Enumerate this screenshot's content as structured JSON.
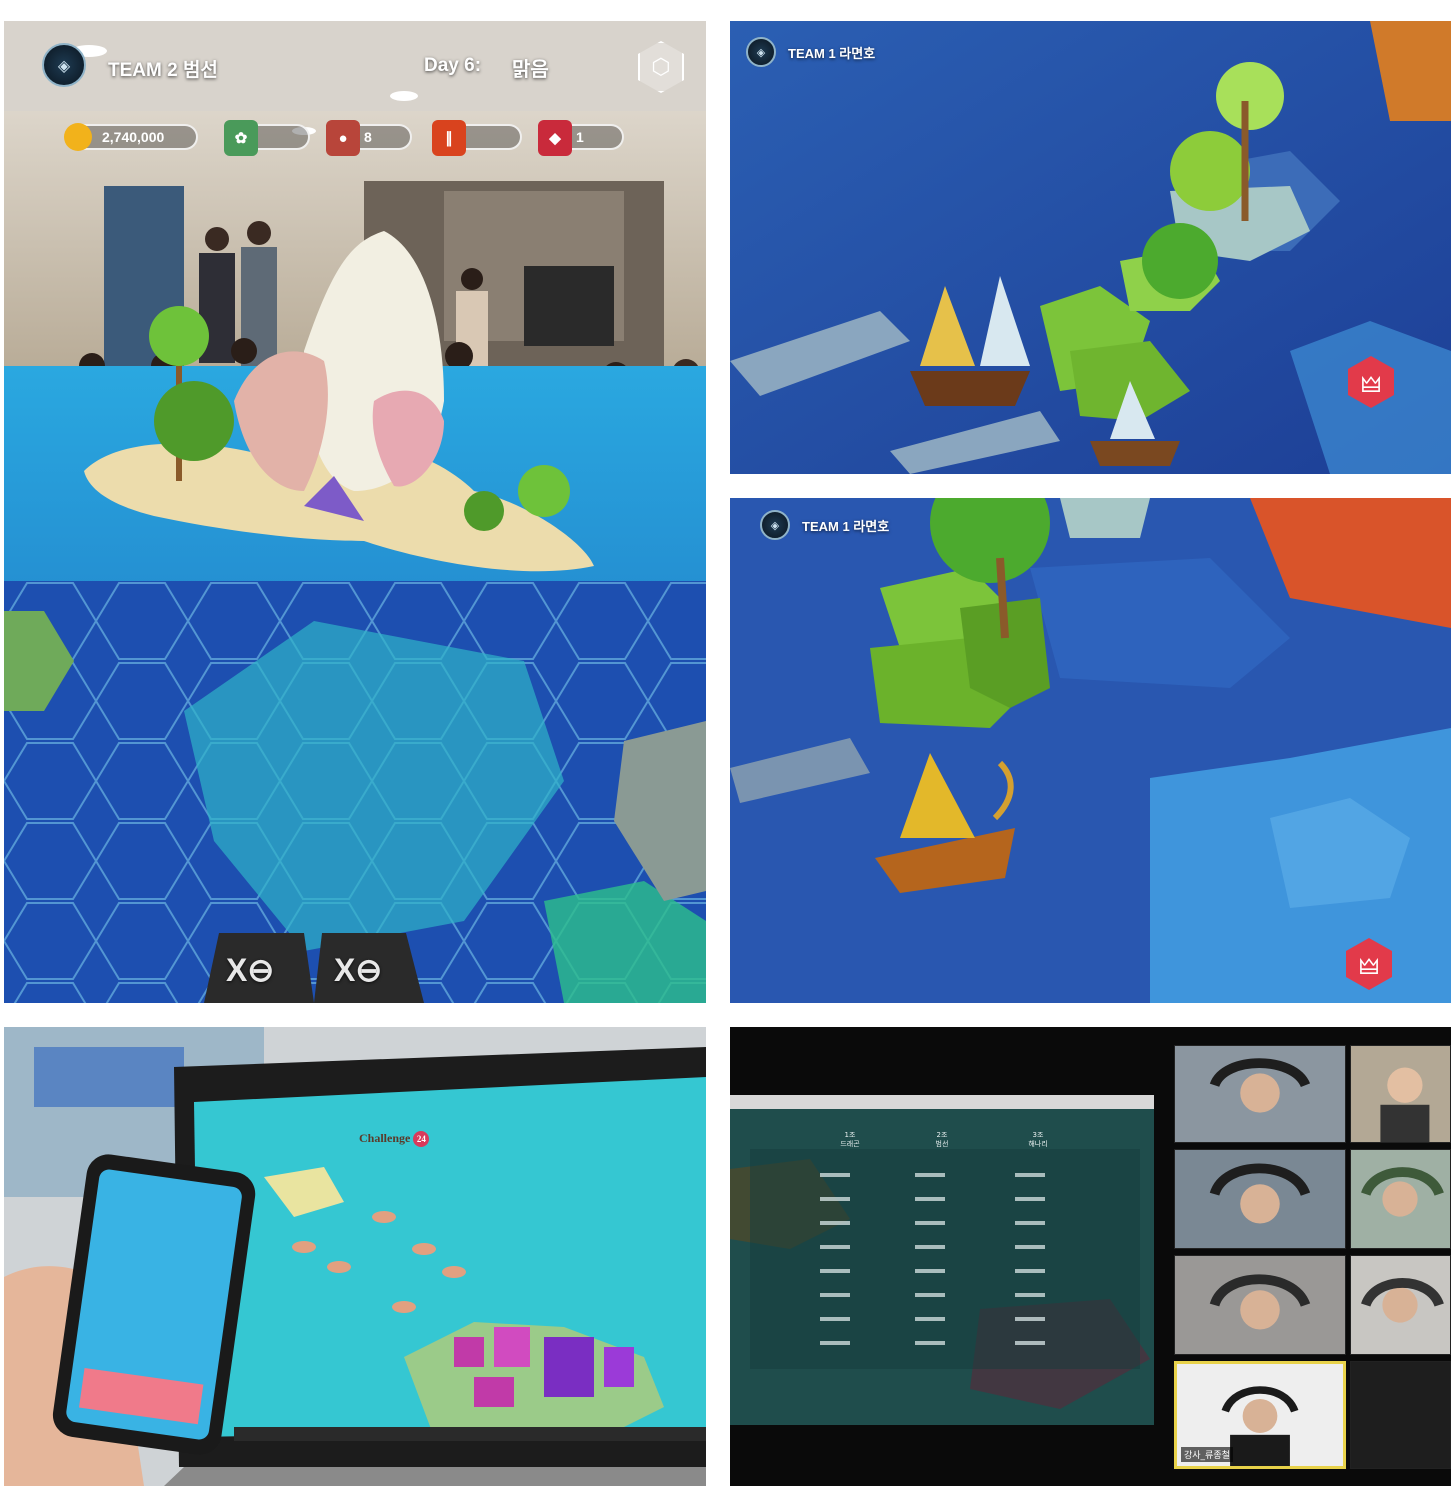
{
  "panels": {
    "ar_game": {
      "team_label": "TEAM 2 범선",
      "day_label": "Day 6:",
      "weather": "맑음",
      "resources": [
        {
          "icon": "coin-icon",
          "value": "2,740,000",
          "color": "#f2b21b"
        },
        {
          "icon": "herb-icon",
          "value": "",
          "color": "#4a9a5a"
        },
        {
          "icon": "meat-icon",
          "value": "8",
          "color": "#b8453a"
        },
        {
          "icon": "tool-icon",
          "value": "",
          "color": "#d9431e"
        },
        {
          "icon": "ruby-icon",
          "value": "1",
          "color": "#c92a3b"
        }
      ],
      "tile_marks": [
        "X⊖",
        "X⊖"
      ]
    },
    "ship_scene_1": {
      "team_label": "TEAM 1 라면호"
    },
    "ship_scene_2": {
      "team_label": "TEAM 1 라면호"
    },
    "laptop_scene": {
      "window_title": "Challenge",
      "badge": "24"
    },
    "video_call": {
      "scoreboard_headers": [
        "1조\n드래곤",
        "2조\n범선",
        "3조\n해나리"
      ],
      "presenter_label": "강사_류종철"
    }
  },
  "colors": {
    "ocean_dark": "#1a4fa8",
    "ocean_light": "#3fb2d8",
    "accent_hex": "#e23a4a",
    "grass": "#7cc43a"
  }
}
